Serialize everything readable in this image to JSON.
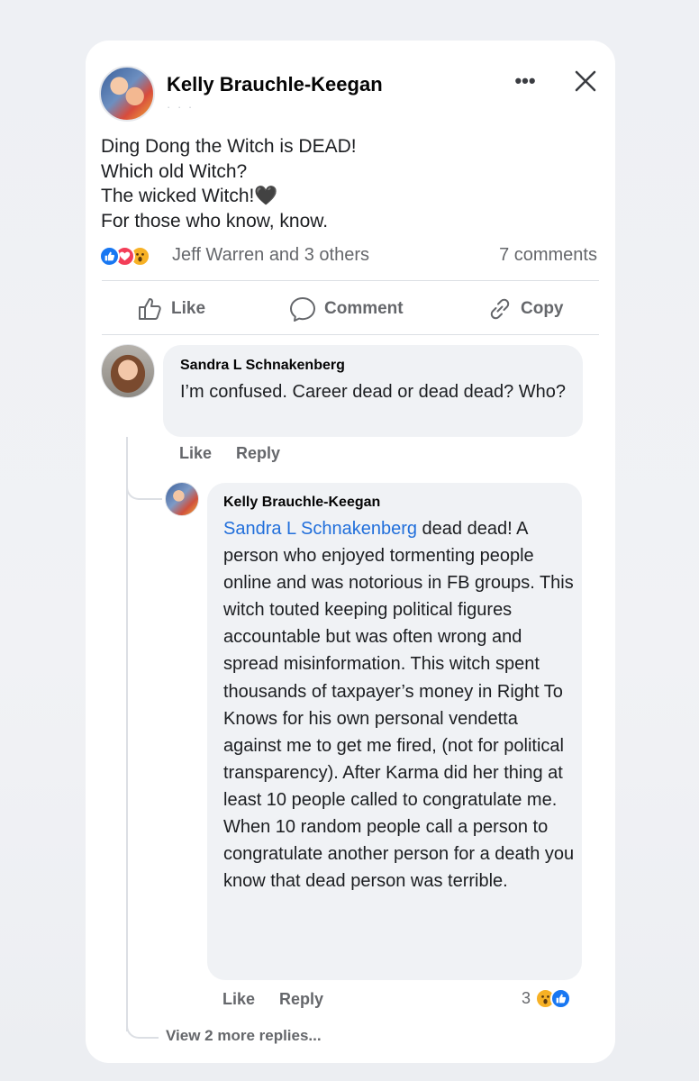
{
  "post": {
    "author": "Kelly Brauchle-Keegan",
    "meta": "· · ·",
    "more_label": "•••",
    "lines": [
      "Ding Dong the Witch is DEAD!",
      "Which old Witch?",
      "The wicked Witch!🖤",
      "For those who know, know."
    ],
    "reactions_text": "Jeff Warren and 3 others",
    "comments_count": "7 comments"
  },
  "actions": {
    "like": "Like",
    "comment": "Comment",
    "copy": "Copy"
  },
  "comments": [
    {
      "author": "Sandra L Schnakenberg",
      "text": "I’m confused. Career dead or dead dead? Who?",
      "like": "Like",
      "reply": "Reply"
    },
    {
      "author": "Kelly Brauchle-Keegan",
      "mention": "Sandra L Schnakenberg",
      "text": " dead dead! A person who enjoyed tormenting people online and was notorious in FB groups. This witch touted keeping political figures accountable but was often wrong and spread misinformation. This witch spent thousands of taxpayer’s money in Right To Knows for his own personal vendetta against me to get me fired, (not for political transparency). After Karma did her thing at least 10 people called to congratulate me. When 10 random people call a person to congratulate another person for a death you know that dead person was terrible.",
      "like": "Like",
      "reply": "Reply",
      "reaction_count": "3"
    }
  ],
  "view_more": "View 2 more replies...",
  "colors": {
    "like_blue": "#1877f2",
    "love_red": "#f33e58",
    "wow_yellow": "#f7b125",
    "mention_blue": "#216fdb",
    "secondary_text": "#65676b"
  }
}
